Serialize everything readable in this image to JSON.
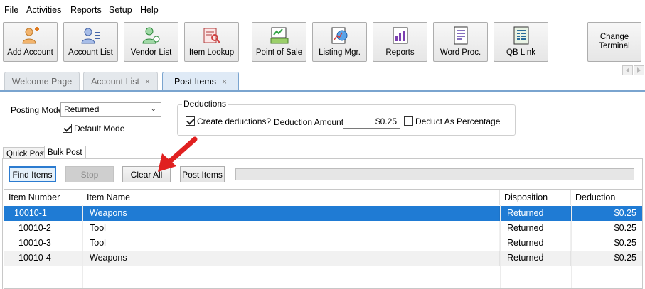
{
  "menu": [
    "File",
    "Activities",
    "Reports",
    "Setup",
    "Help"
  ],
  "toolbar": {
    "buttons": [
      {
        "label": "Add Account",
        "icon": "add-account-icon"
      },
      {
        "label": "Account List",
        "icon": "account-list-icon"
      },
      {
        "label": "Vendor List",
        "icon": "vendor-list-icon"
      },
      {
        "label": "Item Lookup",
        "icon": "item-lookup-icon"
      },
      {
        "label": "Point of Sale",
        "icon": "point-of-sale-icon"
      },
      {
        "label": "Listing Mgr.",
        "icon": "listing-manager-icon"
      },
      {
        "label": "Reports",
        "icon": "reports-icon"
      },
      {
        "label": "Word Proc.",
        "icon": "word-processor-icon"
      },
      {
        "label": "QB Link",
        "icon": "qb-link-icon"
      }
    ],
    "change_terminal": "Change Terminal"
  },
  "tabs": [
    {
      "label": "Welcome Page",
      "closable": false
    },
    {
      "label": "Account List",
      "closable": true,
      "close": "×"
    },
    {
      "label": "Post Items",
      "closable": true,
      "close": "×",
      "active": true
    }
  ],
  "posting": {
    "mode_label": "Posting Mode",
    "mode_value": "Returned",
    "default_mode_label": "Default Mode",
    "default_mode_checked": true
  },
  "deductions": {
    "legend": "Deductions",
    "create_label": "Create deductions?",
    "create_checked": true,
    "amount_label": "Deduction Amount",
    "amount_value": "$0.25",
    "percentage_label": "Deduct As Percentage",
    "percentage_checked": false
  },
  "subtabs": [
    "Quick Post",
    "Bulk Post"
  ],
  "actions": {
    "find": "Find Items",
    "stop": "Stop",
    "clear": "Clear All",
    "post": "Post Items"
  },
  "grid": {
    "columns": [
      "Item Number",
      "Item Name",
      "Disposition",
      "Deduction"
    ],
    "rows": [
      {
        "number": "10010-1",
        "name": "Weapons",
        "disposition": "Returned",
        "deduction": "$0.25",
        "selected": true
      },
      {
        "number": "10010-2",
        "name": "Tool",
        "disposition": "Returned",
        "deduction": "$0.25"
      },
      {
        "number": "10010-3",
        "name": "Tool",
        "disposition": "Returned",
        "deduction": "$0.25"
      },
      {
        "number": "10010-4",
        "name": "Weapons",
        "disposition": "Returned",
        "deduction": "$0.25"
      }
    ]
  },
  "colors": {
    "selection": "#1f7bd4",
    "active_tab_border": "#7aa4cf",
    "annotation_arrow": "#e02020"
  }
}
